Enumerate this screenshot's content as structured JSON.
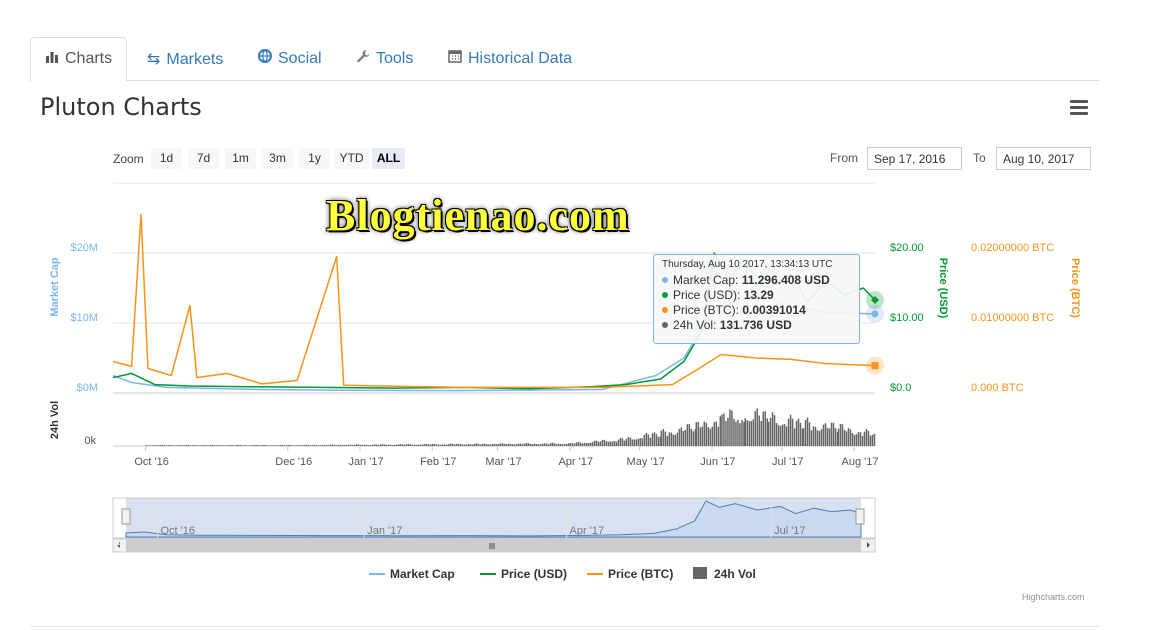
{
  "tabs": [
    {
      "label": "Charts",
      "icon": "bar-chart-icon",
      "active": true
    },
    {
      "label": "Markets",
      "icon": "exchange-icon"
    },
    {
      "label": "Social",
      "icon": "globe-icon"
    },
    {
      "label": "Tools",
      "icon": "wrench-icon"
    },
    {
      "label": "Historical Data",
      "icon": "calendar-icon"
    }
  ],
  "page_title": "Pluton Charts",
  "zoom": {
    "label": "Zoom",
    "buttons": [
      "1d",
      "7d",
      "1m",
      "3m",
      "1y",
      "YTD",
      "ALL"
    ],
    "selected": "ALL"
  },
  "date_range": {
    "from_label": "From",
    "from_value": "Sep 17, 2016",
    "to_label": "To",
    "to_value": "Aug 10, 2017"
  },
  "watermark": "Blogtienao.com",
  "tooltip": {
    "header": "Thursday, Aug 10 2017, 13:34:13 UTC",
    "rows": [
      {
        "label": "Market Cap:",
        "value": "11.296.408 USD",
        "color": "#7cb5ec"
      },
      {
        "label": "Price (USD):",
        "value": "13.29",
        "color": "#009933"
      },
      {
        "label": "Price (BTC):",
        "value": "0.00391014",
        "color": "#f7931a"
      },
      {
        "label": "24h Vol:",
        "value": "131.736 USD",
        "color": "#666666"
      }
    ]
  },
  "legend": [
    {
      "name": "Market Cap",
      "color": "#7cb5ec",
      "shape": "line"
    },
    {
      "name": "Price (USD)",
      "color": "#009933",
      "shape": "line"
    },
    {
      "name": "Price (BTC)",
      "color": "#f7931a",
      "shape": "line"
    },
    {
      "name": "24h Vol",
      "color": "#666666",
      "shape": "box"
    }
  ],
  "credits": "Highcharts.com",
  "chart_data": {
    "type": "line",
    "x_range": [
      "2016-09-17",
      "2017-08-10"
    ],
    "x_ticks": [
      "Oct '16",
      "Dec '16",
      "Jan '17",
      "Feb '17",
      "Mar '17",
      "Apr '17",
      "May '17",
      "Jun '17",
      "Jul '17",
      "Aug '17"
    ],
    "navigator_ticks": [
      "Oct '16",
      "Jan '17",
      "Apr '17",
      "Jul '17"
    ],
    "axes": {
      "market_cap": {
        "label": "Market Cap",
        "ticks": [
          "$0M",
          "$10M",
          "$20M"
        ],
        "range": [
          0,
          20000000
        ],
        "color": "#7cb5ec"
      },
      "price_usd": {
        "label": "Price (USD)",
        "ticks": [
          "$0.0",
          "$10.00",
          "$20.00"
        ],
        "range": [
          0,
          20
        ],
        "color": "#009933"
      },
      "price_btc": {
        "label": "Price (BTC)",
        "ticks": [
          "0.000 BTC",
          "0.01000000 BTC",
          "0.02000000 BTC"
        ],
        "range": [
          0,
          0.02
        ],
        "color": "#f7931a"
      },
      "volume": {
        "label": "24h Vol",
        "ticks": [
          "0k"
        ],
        "color": "#666666"
      }
    },
    "grid": true,
    "series": [
      {
        "name": "Market Cap",
        "axis": "market_cap",
        "color": "#7cb5ec",
        "points": [
          [
            "2016-09-17",
            2500000
          ],
          [
            "2016-09-25",
            1500000
          ],
          [
            "2016-10-10",
            800000
          ],
          [
            "2016-11-20",
            500000
          ],
          [
            "2016-12-25",
            400000
          ],
          [
            "2017-02-10",
            350000
          ],
          [
            "2017-04-15",
            500000
          ],
          [
            "2017-05-08",
            2500000
          ],
          [
            "2017-05-20",
            5000000
          ],
          [
            "2017-06-02",
            12000000
          ],
          [
            "2017-06-20",
            14000000
          ],
          [
            "2017-07-05",
            12500000
          ],
          [
            "2017-07-20",
            11500000
          ],
          [
            "2017-08-10",
            11296408
          ]
        ]
      },
      {
        "name": "Price (USD)",
        "axis": "price_usd",
        "color": "#009933",
        "points": [
          [
            "2016-09-17",
            2.2
          ],
          [
            "2016-09-25",
            2.8
          ],
          [
            "2016-10-05",
            1.2
          ],
          [
            "2016-10-20",
            1.0
          ],
          [
            "2016-11-15",
            0.9
          ],
          [
            "2016-12-15",
            0.8
          ],
          [
            "2017-01-15",
            0.7
          ],
          [
            "2017-02-15",
            0.8
          ],
          [
            "2017-03-15",
            0.6
          ],
          [
            "2017-04-10",
            0.9
          ],
          [
            "2017-04-25",
            1.2
          ],
          [
            "2017-05-10",
            2.0
          ],
          [
            "2017-05-20",
            4.5
          ],
          [
            "2017-05-28",
            9.0
          ],
          [
            "2017-06-02",
            20.0
          ],
          [
            "2017-06-08",
            16.5
          ],
          [
            "2017-06-15",
            18.5
          ],
          [
            "2017-06-25",
            15.0
          ],
          [
            "2017-07-05",
            17.0
          ],
          [
            "2017-07-12",
            13.0
          ],
          [
            "2017-07-20",
            16.0
          ],
          [
            "2017-07-28",
            14.0
          ],
          [
            "2017-08-05",
            15.0
          ],
          [
            "2017-08-10",
            13.29
          ]
        ]
      },
      {
        "name": "Price (BTC)",
        "axis": "price_btc",
        "color": "#f7931a",
        "points": [
          [
            "2016-09-17",
            0.0045
          ],
          [
            "2016-09-25",
            0.0038
          ],
          [
            "2016-09-29",
            0.0255
          ],
          [
            "2016-10-02",
            0.0035
          ],
          [
            "2016-10-12",
            0.0025
          ],
          [
            "2016-10-20",
            0.0125
          ],
          [
            "2016-10-23",
            0.0022
          ],
          [
            "2016-11-05",
            0.0028
          ],
          [
            "2016-11-20",
            0.0013
          ],
          [
            "2016-12-05",
            0.0018
          ],
          [
            "2016-12-22",
            0.0195
          ],
          [
            "2016-12-25",
            0.0011
          ],
          [
            "2017-02-15",
            0.0008
          ],
          [
            "2017-04-15",
            0.0008
          ],
          [
            "2017-05-15",
            0.0012
          ],
          [
            "2017-05-25",
            0.0032
          ],
          [
            "2017-06-05",
            0.0055
          ],
          [
            "2017-06-20",
            0.005
          ],
          [
            "2017-07-05",
            0.0048
          ],
          [
            "2017-07-20",
            0.0042
          ],
          [
            "2017-08-10",
            0.00391014
          ]
        ]
      },
      {
        "name": "24h Vol",
        "axis": "volume",
        "color": "#666666",
        "type": "column",
        "points": [
          [
            "2016-10-01",
            10000
          ],
          [
            "2016-12-01",
            10000
          ],
          [
            "2017-04-01",
            30000
          ],
          [
            "2017-04-25",
            80000
          ],
          [
            "2017-05-10",
            150000
          ],
          [
            "2017-05-25",
            220000
          ],
          [
            "2017-06-05",
            320000
          ],
          [
            "2017-06-15",
            380000
          ],
          [
            "2017-06-25",
            330000
          ],
          [
            "2017-07-10",
            260000
          ],
          [
            "2017-07-25",
            210000
          ],
          [
            "2017-08-10",
            131736
          ]
        ]
      }
    ],
    "annotations": [
      "Thursday, Aug 10 2017, 13:34:13 UTC"
    ]
  }
}
